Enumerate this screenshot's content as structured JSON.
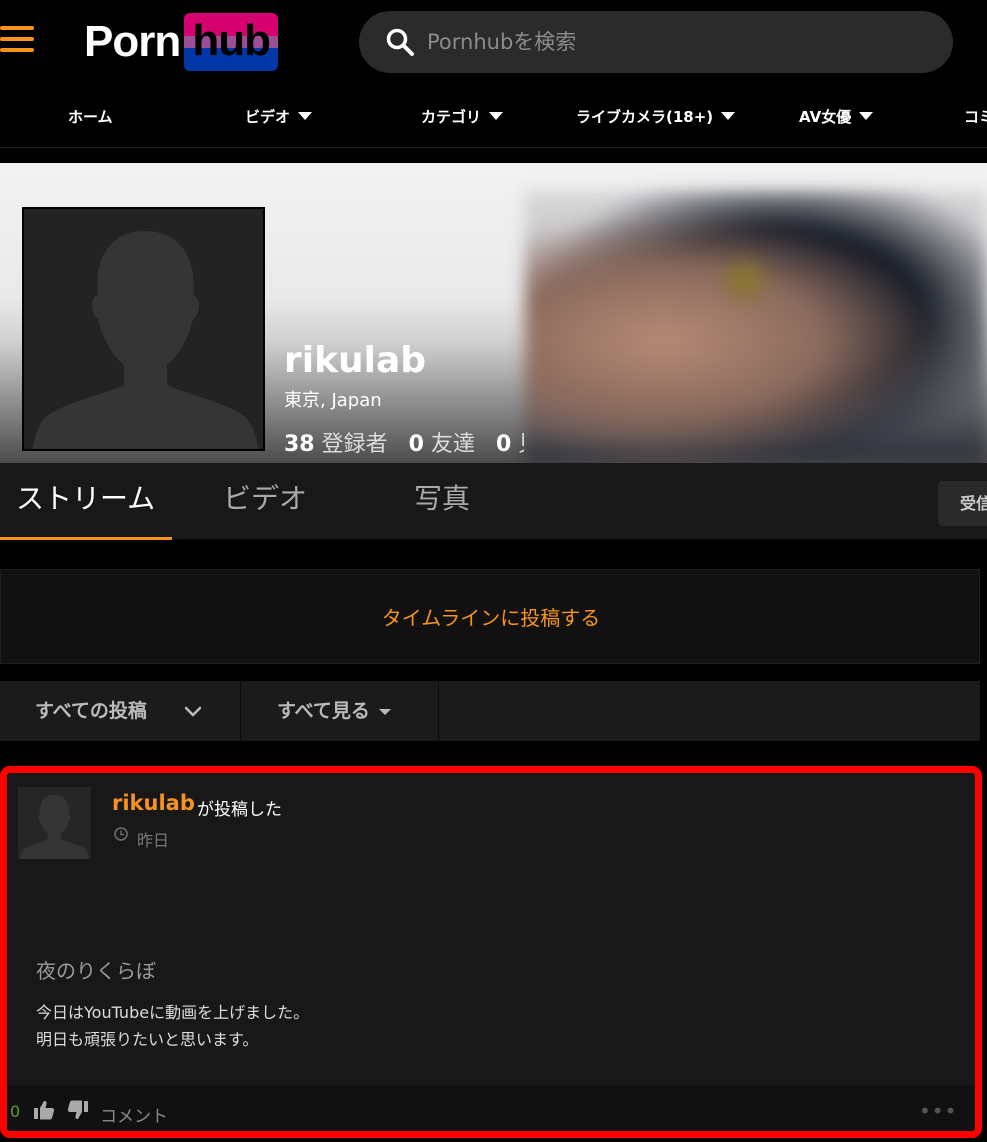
{
  "header": {
    "logo_left": "Porn",
    "logo_right": "hub",
    "search_placeholder": "Pornhubを検索"
  },
  "nav": {
    "items": [
      {
        "label": "ホーム",
        "dropdown": false
      },
      {
        "label": "ビデオ",
        "dropdown": true
      },
      {
        "label": "カテゴリ",
        "dropdown": true
      },
      {
        "label": "ライブカメラ(18+)",
        "dropdown": true
      },
      {
        "label": "AV女優",
        "dropdown": true
      },
      {
        "label": "コミ",
        "dropdown": false
      }
    ]
  },
  "profile": {
    "name": "rikulab",
    "location": "東京, Japan",
    "stats": [
      {
        "count": "38",
        "label": "登録者"
      },
      {
        "count": "0",
        "label": "友達"
      },
      {
        "count": "0",
        "label": "見"
      }
    ]
  },
  "tabs": {
    "items": [
      "ストリーム",
      "ビデオ",
      "写真"
    ],
    "active": 0,
    "right_button": "受信"
  },
  "timeline": {
    "post_prompt": "タイムラインに投稿する"
  },
  "filters": {
    "posts_filter": "すべての投稿",
    "view_filter": "すべて見る"
  },
  "post": {
    "author": "rikulab",
    "action": "が投稿した",
    "time": "昨日",
    "title": "夜のりくらぼ",
    "body_line1": "今日はYouTubeに動画を上げました。",
    "body_line2": "明日も頑張りたいと思います。",
    "likes": "0",
    "comment_label": "コメント",
    "more": "•••"
  },
  "colors": {
    "accent": "#f7931e",
    "highlight_border": "#ff0000",
    "like_count": "#5aa02c"
  }
}
